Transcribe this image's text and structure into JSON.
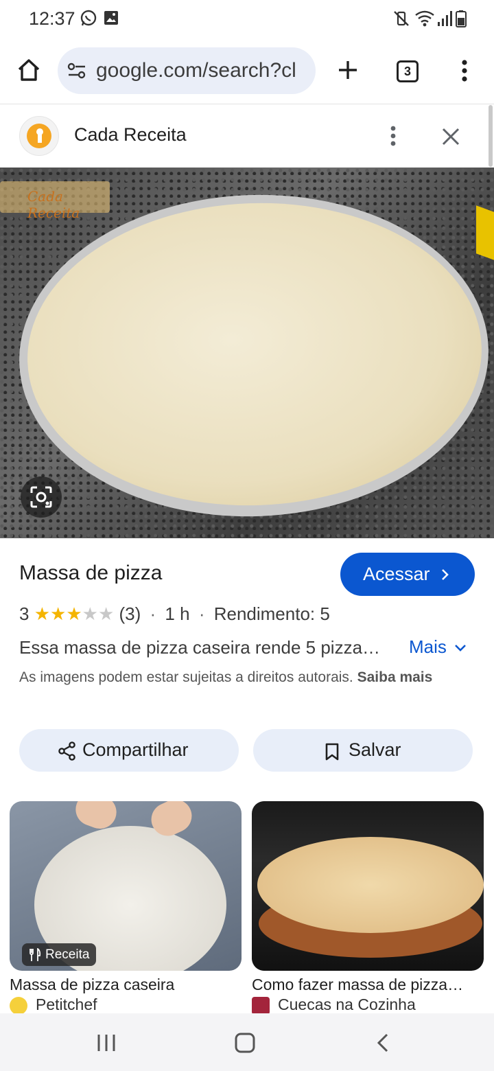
{
  "status_bar": {
    "time": "12:37",
    "left_icons": [
      "whatsapp-icon",
      "gallery-icon"
    ],
    "right_icons": [
      "vibrate-mute-icon",
      "wifi-icon",
      "signal-icon",
      "battery-icon"
    ]
  },
  "browser": {
    "url": "google.com/search?cl",
    "tab_count": "3",
    "icons": [
      "home-icon",
      "site-settings-icon",
      "new-tab-icon",
      "more-vert-icon"
    ]
  },
  "sheet": {
    "site_name": "Cada Receita",
    "watermark": "Cada Receita"
  },
  "result": {
    "title": "Massa de pizza",
    "visit_label": "Acessar",
    "rating_value": "3",
    "rating_stars": 3,
    "rating_max": 5,
    "rating_count": "(3)",
    "time": "1 h",
    "yield": "Rendimento: 5",
    "description": "Essa massa de pizza caseira rende 5 pizza…",
    "more_label": "Mais",
    "copyright_notice": "As imagens podem estar sujeitas a direitos autorais.",
    "learn_more": "Saiba mais"
  },
  "actions": {
    "share_label": "Compartilhar",
    "save_label": "Salvar"
  },
  "related": [
    {
      "badge": "Receita",
      "title": "Massa de pizza caseira",
      "source": "Petitchef"
    },
    {
      "title": "Como fazer massa de pizza…",
      "source": "Cuecas na Cozinha"
    }
  ],
  "colors": {
    "accent": "#0b57d0",
    "chip_bg": "#e8eef9",
    "star": "#f4b400"
  }
}
